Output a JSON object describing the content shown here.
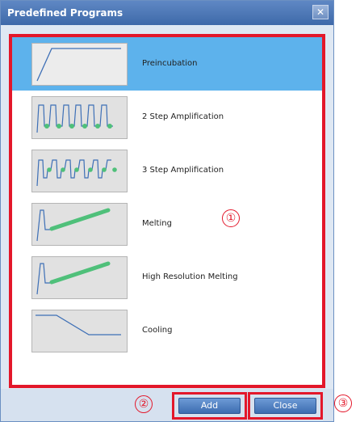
{
  "window": {
    "title": "Predefined Programs",
    "close_icon": "close-icon"
  },
  "programs": [
    {
      "label": "Preincubation",
      "icon": "preincubation-curve-icon",
      "selected": true
    },
    {
      "label": "2 Step Amplification",
      "icon": "two-step-amplification-curve-icon",
      "selected": false
    },
    {
      "label": "3 Step Amplification",
      "icon": "three-step-amplification-curve-icon",
      "selected": false
    },
    {
      "label": "Melting",
      "icon": "melting-curve-icon",
      "selected": false
    },
    {
      "label": "High Resolution Melting",
      "icon": "high-resolution-melting-curve-icon",
      "selected": false
    },
    {
      "label": "Cooling",
      "icon": "cooling-curve-icon",
      "selected": false
    }
  ],
  "annotations": {
    "list": "①",
    "add": "②",
    "close": "③"
  },
  "buttons": {
    "add": "Add",
    "close": "Close"
  },
  "colors": {
    "selection": "#5db2ec",
    "highlight": "#e3172a",
    "curve": "#3d6fb6",
    "marker": "#4fc07a"
  }
}
